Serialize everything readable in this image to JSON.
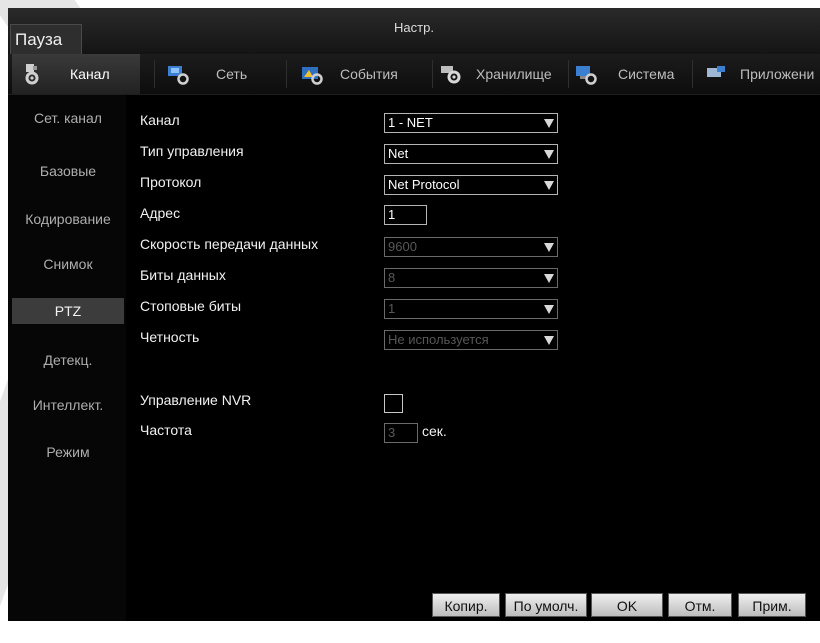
{
  "window": {
    "title": "Настр.",
    "pause_label": "Пауза"
  },
  "tabs": [
    {
      "label": "Канал",
      "icon": "camera-gear-icon",
      "active": true
    },
    {
      "label": "Сеть",
      "icon": "network-gear-icon",
      "active": false
    },
    {
      "label": "События",
      "icon": "events-gear-icon",
      "active": false
    },
    {
      "label": "Хранилище",
      "icon": "storage-gear-icon",
      "active": false
    },
    {
      "label": "Система",
      "icon": "system-gear-icon",
      "active": false
    },
    {
      "label": "Приложени",
      "icon": "app-icon",
      "active": false
    }
  ],
  "sidebar": {
    "items": [
      {
        "label": "Сет. канал"
      },
      {
        "label": "Базовые"
      },
      {
        "label": "Кодирование"
      },
      {
        "label": "Снимок"
      },
      {
        "label": "PTZ",
        "active": true
      },
      {
        "label": "Детекц."
      },
      {
        "label": "Интеллект."
      },
      {
        "label": "Режим"
      }
    ]
  },
  "form": {
    "channel": {
      "label": "Канал",
      "value": "1 - NET"
    },
    "control_type": {
      "label": "Тип управления",
      "value": "Net"
    },
    "protocol": {
      "label": "Протокол",
      "value": "Net Protocol"
    },
    "address": {
      "label": "Адрес",
      "value": "1"
    },
    "baud_rate": {
      "label": "Скорость передачи данных",
      "value": "9600"
    },
    "data_bits": {
      "label": "Биты данных",
      "value": "8"
    },
    "stop_bits": {
      "label": "Стоповые биты",
      "value": "1"
    },
    "parity": {
      "label": "Четность",
      "value": "Не используется"
    },
    "nvr_control": {
      "label": "Управление NVR",
      "checked": false
    },
    "frequency": {
      "label": "Частота",
      "value": "3",
      "unit": "сек."
    }
  },
  "buttons": {
    "copy": "Копир.",
    "default": "По умолч.",
    "ok": "OK",
    "cancel": "Отм.",
    "apply": "Прим."
  },
  "colors": {
    "background": "#000000",
    "active_item": "#3c3c3c",
    "disabled_text": "#575757"
  }
}
